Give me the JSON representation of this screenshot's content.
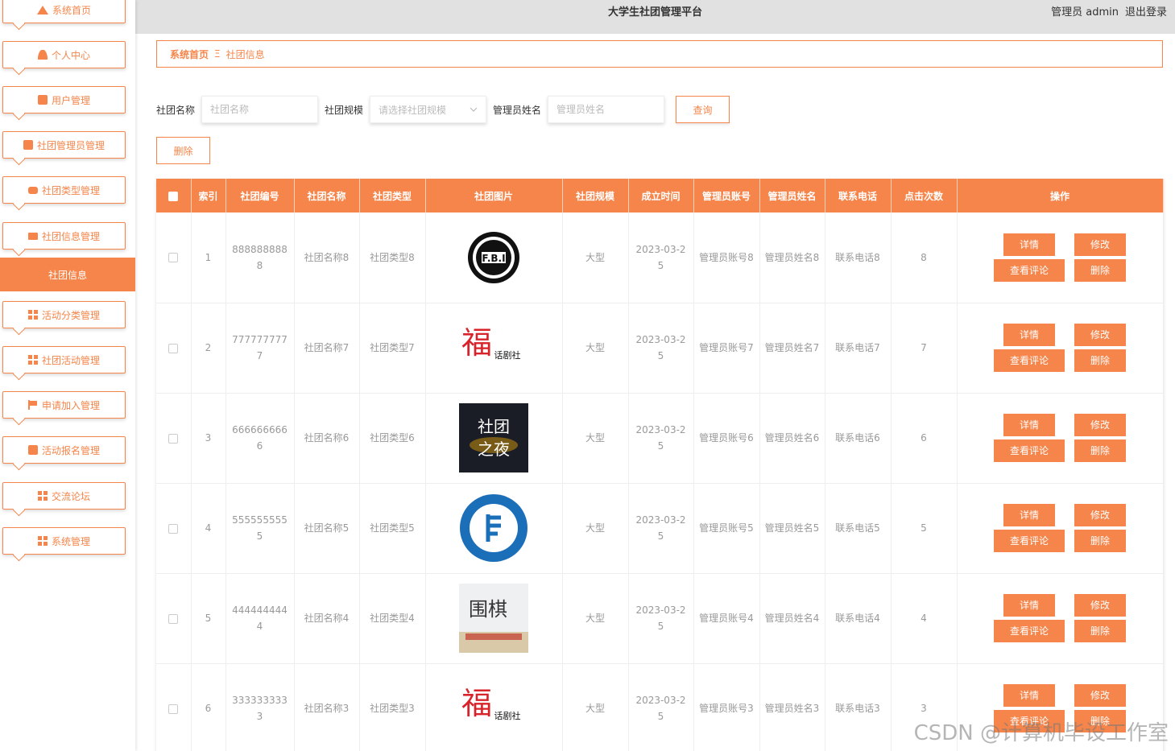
{
  "header": {
    "title": "大学生社团管理平台",
    "user_label": "管理员 admin",
    "logout": "退出登录"
  },
  "sidebar": {
    "items": [
      {
        "label": "系统首页",
        "icon": "home-icon"
      },
      {
        "label": "个人中心",
        "icon": "person-icon"
      },
      {
        "label": "用户管理",
        "icon": "briefcase-icon"
      },
      {
        "label": "社团管理员管理",
        "icon": "clipboard-icon"
      },
      {
        "label": "社团类型管理",
        "icon": "chat-icon"
      },
      {
        "label": "社团信息管理",
        "icon": "monitor-icon"
      },
      {
        "label": "活动分类管理",
        "icon": "grid-icon"
      },
      {
        "label": "社团活动管理",
        "icon": "grid-icon"
      },
      {
        "label": "申请加入管理",
        "icon": "flag-icon"
      },
      {
        "label": "活动报名管理",
        "icon": "chart-icon"
      },
      {
        "label": "交流论坛",
        "icon": "grid-icon"
      },
      {
        "label": "系统管理",
        "icon": "grid-icon"
      }
    ],
    "active_sub": "社团信息"
  },
  "breadcrumb": {
    "home": "系统首页",
    "sep": "Ξ",
    "current": "社团信息"
  },
  "search": {
    "name_label": "社团名称",
    "name_placeholder": "社团名称",
    "scale_label": "社团规模",
    "scale_placeholder": "请选择社团规模",
    "admin_label": "管理员姓名",
    "admin_placeholder": "管理员姓名",
    "query": "查询"
  },
  "toolbar": {
    "delete": "删除"
  },
  "table": {
    "headers": [
      "索引",
      "社团编号",
      "社团名称",
      "社团类型",
      "社团图片",
      "社团规模",
      "成立时间",
      "管理员账号",
      "管理员姓名",
      "联系电话",
      "点击次数",
      "操作"
    ],
    "ops": {
      "detail": "详情",
      "edit": "修改",
      "comments": "查看评论",
      "delete": "删除"
    },
    "rows": [
      {
        "idx": "1",
        "code": "8888888888",
        "name": "社团名称8",
        "type": "社团类型8",
        "img": "fbi-logo",
        "scale": "大型",
        "date": "2023-03-25",
        "acct": "管理员账号8",
        "admin": "管理员姓名8",
        "phone": "联系电话8",
        "clicks": "8"
      },
      {
        "idx": "2",
        "code": "7777777777",
        "name": "社团名称7",
        "type": "社团类型7",
        "img": "drama-logo",
        "scale": "大型",
        "date": "2023-03-25",
        "acct": "管理员账号7",
        "admin": "管理员姓名7",
        "phone": "联系电话7",
        "clicks": "7"
      },
      {
        "idx": "3",
        "code": "6666666666",
        "name": "社团名称6",
        "type": "社团类型6",
        "img": "night-poster",
        "scale": "大型",
        "date": "2023-03-25",
        "acct": "管理员账号6",
        "admin": "管理员姓名6",
        "phone": "联系电话6",
        "clicks": "6"
      },
      {
        "idx": "4",
        "code": "5555555555",
        "name": "社团名称5",
        "type": "社团类型5",
        "img": "music-logo",
        "scale": "大型",
        "date": "2023-03-25",
        "acct": "管理员账号5",
        "admin": "管理员姓名5",
        "phone": "联系电话5",
        "clicks": "5"
      },
      {
        "idx": "5",
        "code": "4444444444",
        "name": "社团名称4",
        "type": "社团类型4",
        "img": "go-room",
        "scale": "大型",
        "date": "2023-03-25",
        "acct": "管理员账号4",
        "admin": "管理员姓名4",
        "phone": "联系电话4",
        "clicks": "4"
      },
      {
        "idx": "6",
        "code": "3333333333",
        "name": "社团名称3",
        "type": "社团类型3",
        "img": "drama-logo",
        "scale": "大型",
        "date": "2023-03-25",
        "acct": "管理员账号3",
        "admin": "管理员姓名3",
        "phone": "联系电话3",
        "clicks": "3"
      }
    ]
  },
  "colors": {
    "accent": "#f5854a",
    "header_bg": "#e1e1e1"
  },
  "watermark": "CSDN @计算机毕设工作室"
}
